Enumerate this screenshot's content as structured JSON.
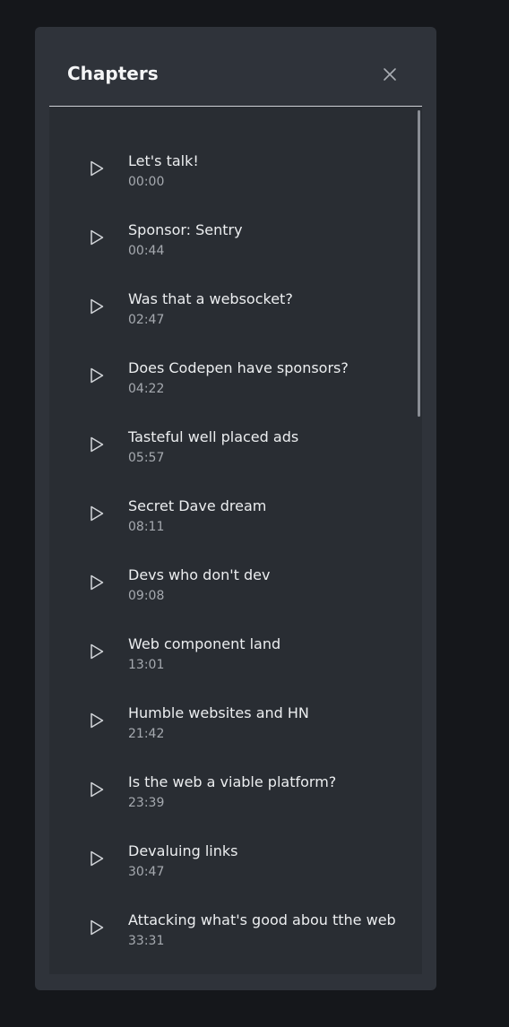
{
  "header": {
    "title": "Chapters"
  },
  "chapters": [
    {
      "title": "Let's talk!",
      "time": "00:00"
    },
    {
      "title": "Sponsor: Sentry",
      "time": "00:44"
    },
    {
      "title": "Was that a websocket?",
      "time": "02:47"
    },
    {
      "title": "Does Codepen have sponsors?",
      "time": "04:22"
    },
    {
      "title": "Tasteful well placed ads",
      "time": "05:57"
    },
    {
      "title": "Secret Dave dream",
      "time": "08:11"
    },
    {
      "title": "Devs who don't dev",
      "time": "09:08"
    },
    {
      "title": "Web component land",
      "time": "13:01"
    },
    {
      "title": "Humble websites and HN",
      "time": "21:42"
    },
    {
      "title": "Is the web a viable platform?",
      "time": "23:39"
    },
    {
      "title": "Devaluing links",
      "time": "30:47"
    },
    {
      "title": "Attacking what's good abou tthe web",
      "time": "33:31"
    }
  ],
  "icons": {
    "close": "close-icon",
    "play": "play-icon"
  }
}
